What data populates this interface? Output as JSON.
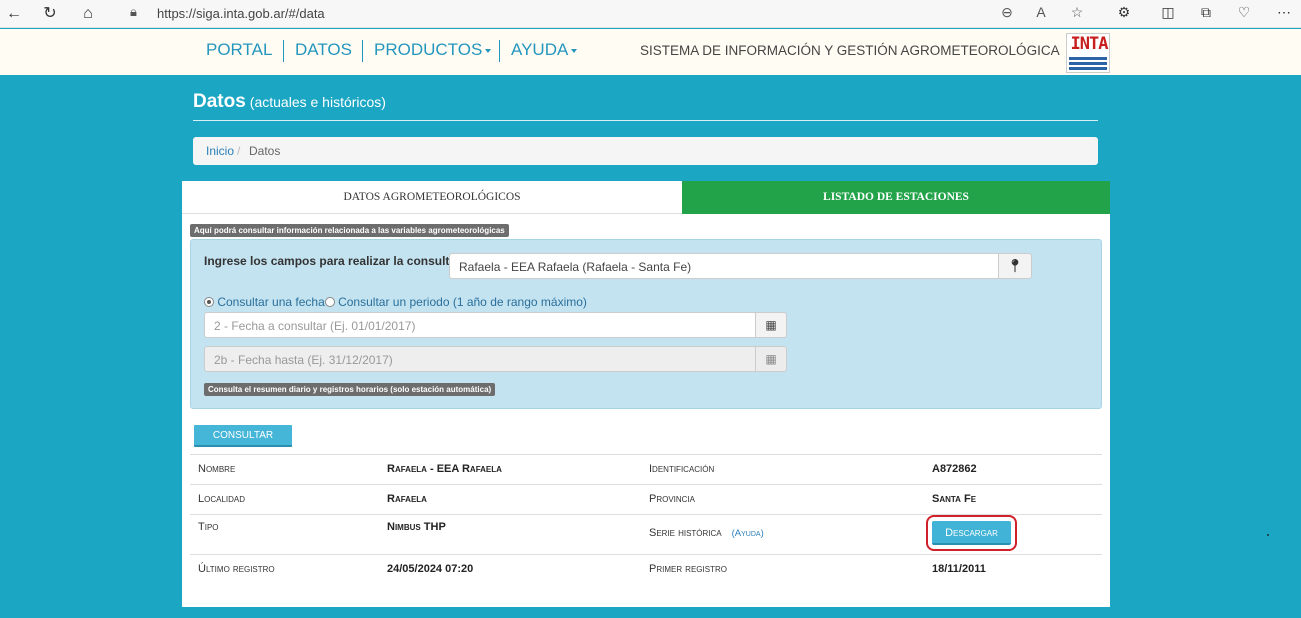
{
  "browser": {
    "url": "https://siga.inta.gob.ar/#/data"
  },
  "nav": {
    "portal": "PORTAL",
    "datos": "DATOS",
    "productos": "PRODUCTOS",
    "ayuda": "AYUDA",
    "site_title": "SISTEMA DE INFORMACIÓN Y GESTIÓN AGROMETEOROLÓGICA",
    "logo_text": "INTA"
  },
  "page": {
    "title": "Datos",
    "subtitle": "(actuales e históricos)"
  },
  "breadcrumb": {
    "home": "Inicio",
    "separator": "/",
    "current": "Datos"
  },
  "tabs": {
    "datos": "DATOS AGROMETEOROLÓGICOS",
    "estaciones": "LISTADO DE ESTACIONES"
  },
  "form": {
    "info_label": "Aquí podrá consultar información relacionada a las variables agrometeorológicas",
    "fields_label": "Ingrese los campos para realizar la consulta",
    "station_value": "Rafaela - EEA Rafaela (Rafaela - Santa Fe)",
    "radio_fecha": "Consultar una fecha",
    "radio_periodo": "Consultar un periodo (1 año de rango máximo)",
    "date_placeholder": "2 - Fecha a consultar (Ej. 01/01/2017)",
    "date_to_placeholder": "2b - Fecha hasta (Ej. 31/12/2017)",
    "note": "Consulta el resumen diario y registros horarios (solo estación automática)",
    "consult_button": "CONSULTAR"
  },
  "station_info": {
    "nombre_label": "Nombre",
    "nombre_value": "Rafaela - EEA Rafaela",
    "identificacion_label": "Identificación",
    "identificacion_value": "A872862",
    "localidad_label": "Localidad",
    "localidad_value": "Rafaela",
    "provincia_label": "Provincia",
    "provincia_value": "Santa Fe",
    "tipo_label": "Tipo",
    "tipo_value": "Nimbus THP",
    "serie_label": "Serie histórica",
    "serie_ayuda": "(Ayuda)",
    "descargar_button": "Descargar",
    "ultimo_label": "Último registro",
    "ultimo_value": "24/05/2024 07:20",
    "primer_label": "Primer registro",
    "primer_value": "18/11/2011"
  },
  "colors": {
    "background": "#1ba7c4",
    "accent_green": "#22a34a",
    "button_blue": "#40b3d6",
    "highlight_red": "#d0202a"
  }
}
